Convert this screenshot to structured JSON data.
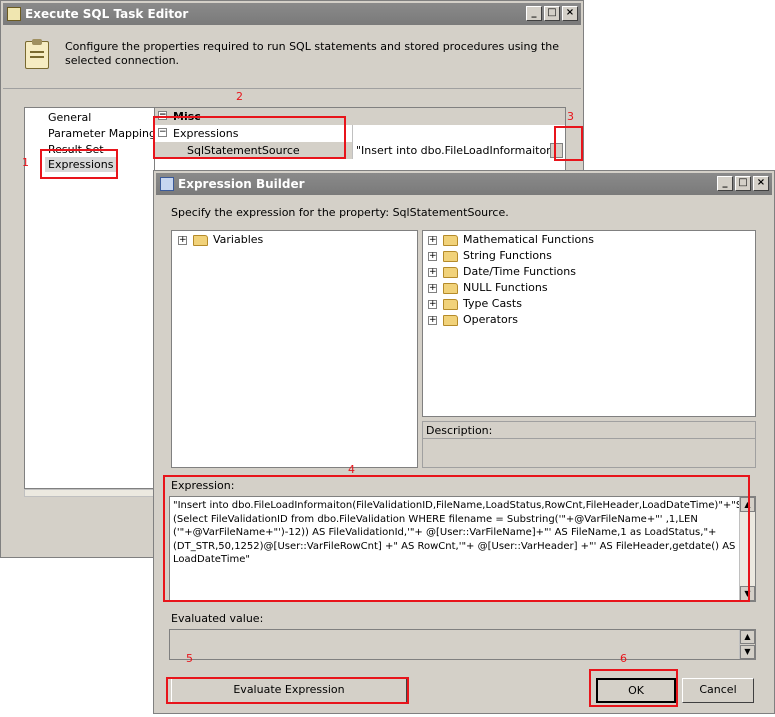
{
  "sql_editor": {
    "title": "Execute SQL Task Editor",
    "description": "Configure the properties required to run SQL statements and stored procedures using the selected connection.",
    "nav_items": [
      "General",
      "Parameter Mapping",
      "Result Set",
      "Expressions"
    ],
    "grid": {
      "category": "Misc",
      "group": "Expressions",
      "property": "SqlStatementSource",
      "value": "\"Insert into dbo.FileLoadInformaiton(FileVali"
    }
  },
  "expr_builder": {
    "title": "Expression Builder",
    "prompt": "Specify the expression for the property: SqlStatementSource.",
    "variables_label": "Variables",
    "functions": [
      "Mathematical Functions",
      "String Functions",
      "Date/Time Functions",
      "NULL Functions",
      "Type Casts",
      "Operators"
    ],
    "description_label": "Description:",
    "expression_label": "Expression:",
    "expression_lines": [
      "\"Insert into dbo.FileLoadInformaiton(FileValidationID,FileName,LoadStatus,RowCnt,FileHeader,LoadDateTime)\"+\"Select",
      "(Select FileValidationID from dbo.FileValidation WHERE filename = Substring('\"+@VarFileName+\"' ,1,LEN",
      "('\"+@VarFileName+\"')-12)) AS FileValidationId,'\"+ @[User::VarFileName]+\"' AS FileName,1 as LoadStatus,\"+",
      "(DT_STR,50,1252)@[User::VarFileRowCnt] +\" AS RowCnt,'\"+ @[User::VarHeader] +\"' AS FileHeader,getdate() AS",
      "LoadDateTime\""
    ],
    "evaluated_label": "Evaluated value:",
    "evaluate_button": "Evaluate Expression",
    "ok_button": "OK",
    "cancel_button": "Cancel"
  },
  "annotations": [
    "1",
    "2",
    "3",
    "4",
    "5",
    "6"
  ],
  "colors": {
    "annotation": "#e8141b",
    "dialog_bg": "#d4d0c8",
    "titlebar_inactive": "#808080"
  }
}
